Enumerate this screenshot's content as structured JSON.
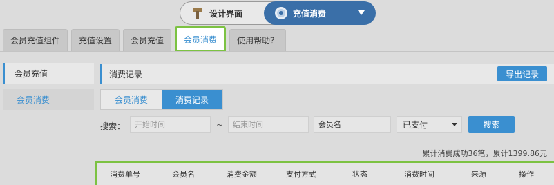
{
  "top_switch": {
    "design_label": "设计界面",
    "recharge_label": "充值消费",
    "design_icon": "tool-icon",
    "recharge_icon": "gear-icon"
  },
  "tabs": [
    {
      "label": "会员充值组件"
    },
    {
      "label": "充值设置"
    },
    {
      "label": "会员充值"
    },
    {
      "label": "会员消费"
    },
    {
      "label": "使用帮助？"
    }
  ],
  "sidebar": {
    "items": [
      {
        "label": "会员充值"
      },
      {
        "label": "会员消费"
      }
    ]
  },
  "main": {
    "title": "消费记录",
    "export_label": "导出记录",
    "seg_tabs": [
      {
        "label": "会员消费"
      },
      {
        "label": "消费记录"
      }
    ],
    "search_label": "搜索：",
    "start_placeholder": "开始时间",
    "tilde": "~",
    "end_placeholder": "结束时间",
    "member_name_value": "会员名",
    "status_selected": "已支付",
    "search_button": "搜索",
    "summary": "累计消费成功36笔，累计1399.86元"
  },
  "table": {
    "columns": [
      "消费单号",
      "会员名",
      "消费金额",
      "支付方式",
      "状态",
      "消费时间",
      "来源",
      "操作"
    ]
  },
  "colors": {
    "accent": "#3a8fd0",
    "highlight": "#7cc242",
    "switch_active": "#3a6fa8"
  }
}
